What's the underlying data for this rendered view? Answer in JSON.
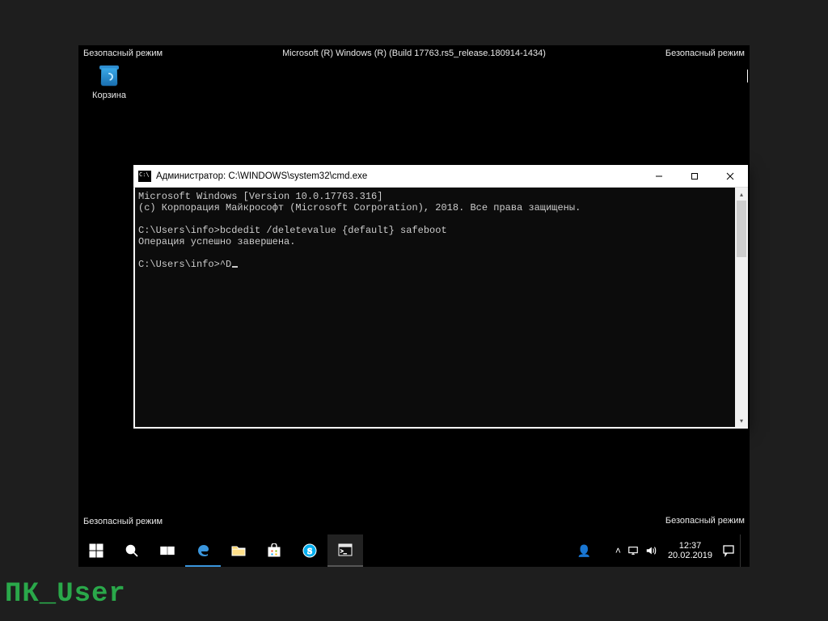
{
  "watermark": "ПК_User",
  "safe_mode": {
    "label": "Безопасный режим",
    "build_line": "Microsoft (R) Windows (R) (Build 17763.rs5_release.180914-1434)"
  },
  "desktop": {
    "recycle_bin_label": "Корзина"
  },
  "cmd": {
    "title": "Администратор: C:\\WINDOWS\\system32\\cmd.exe",
    "lines": {
      "l0": "Microsoft Windows [Version 10.0.17763.316]",
      "l1": "(c) Корпорация Майкрософт (Microsoft Corporation), 2018. Все права защищены.",
      "l2": "",
      "l3": "C:\\Users\\info>bcdedit /deletevalue {default} safeboot",
      "l4": "Операция успешно завершена.",
      "l5": "",
      "l6": "C:\\Users\\info>^D"
    }
  },
  "taskbar": {
    "time": "12:37",
    "date": "20.02.2019"
  }
}
